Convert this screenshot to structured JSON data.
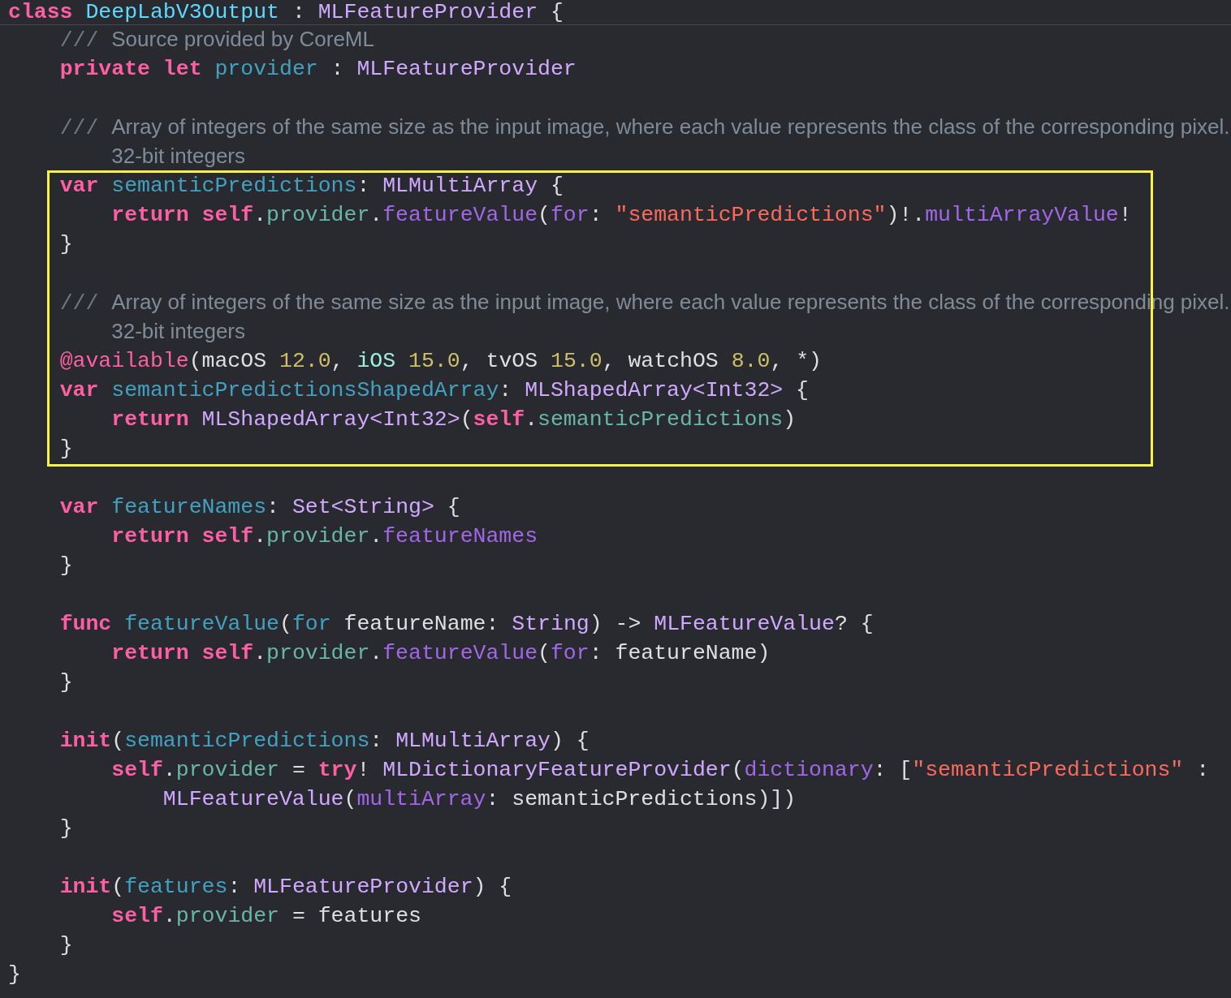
{
  "header": {
    "tokens": [
      {
        "kind": "kw",
        "text": "class "
      },
      {
        "kind": "cls",
        "text": "DeepLabV3Output"
      },
      {
        "kind": "p",
        "text": " : "
      },
      {
        "kind": "type",
        "text": "MLFeatureProvider"
      },
      {
        "kind": "p",
        "text": " {"
      }
    ]
  },
  "lines": [
    {
      "kind": "doc",
      "tokens": [
        {
          "kind": "docmark",
          "text": "    ///"
        },
        {
          "kind": "doc",
          "text": " Source provided by CoreML"
        }
      ]
    },
    {
      "kind": "code",
      "tokens": [
        {
          "kind": "kw",
          "text": "    private let "
        },
        {
          "kind": "decl",
          "text": "provider"
        },
        {
          "kind": "p",
          "text": " : "
        },
        {
          "kind": "type",
          "text": "MLFeatureProvider"
        }
      ]
    },
    {
      "kind": "blank"
    },
    {
      "kind": "doc",
      "tokens": [
        {
          "kind": "docmark",
          "text": "    ///"
        },
        {
          "kind": "doc",
          "text": " Array of integers of the same size as the input image, where each value represents the class of the corresponding pixel."
        }
      ]
    },
    {
      "kind": "doc",
      "tokens": [
        {
          "kind": "doc",
          "text": "        32-bit integers"
        }
      ]
    },
    {
      "kind": "highlight_group",
      "lines": [
        {
          "kind": "code",
          "tokens": [
            {
              "kind": "kw",
              "text": "    var "
            },
            {
              "kind": "decl",
              "text": "semanticPredictions"
            },
            {
              "kind": "p",
              "text": ": "
            },
            {
              "kind": "type",
              "text": "MLMultiArray"
            },
            {
              "kind": "p",
              "text": " {"
            }
          ]
        },
        {
          "kind": "code",
          "tokens": [
            {
              "kind": "kw",
              "text": "        return self"
            },
            {
              "kind": "p",
              "text": "."
            },
            {
              "kind": "ref",
              "text": "provider"
            },
            {
              "kind": "p",
              "text": "."
            },
            {
              "kind": "sys",
              "text": "featureValue"
            },
            {
              "kind": "p",
              "text": "("
            },
            {
              "kind": "sys",
              "text": "for"
            },
            {
              "kind": "p",
              "text": ": "
            },
            {
              "kind": "str",
              "text": "\"semanticPredictions\""
            },
            {
              "kind": "p",
              "text": ")!."
            },
            {
              "kind": "sys",
              "text": "multiArrayValue"
            },
            {
              "kind": "p",
              "text": "!"
            }
          ]
        },
        {
          "kind": "code",
          "tokens": [
            {
              "kind": "p",
              "text": "    }"
            }
          ]
        },
        {
          "kind": "blank"
        },
        {
          "kind": "doc",
          "tokens": [
            {
              "kind": "docmark",
              "text": "    ///"
            },
            {
              "kind": "doc",
              "text": " Array of integers of the same size as the input image, where each value represents the class of the corresponding pixel."
            }
          ]
        },
        {
          "kind": "doc",
          "tokens": [
            {
              "kind": "doc",
              "text": "        32-bit integers"
            }
          ]
        },
        {
          "kind": "code",
          "tokens": [
            {
              "kind": "attr",
              "text": "    @available"
            },
            {
              "kind": "p",
              "text": "(macOS "
            },
            {
              "kind": "num",
              "text": "12.0"
            },
            {
              "kind": "p",
              "text": ", "
            },
            {
              "kind": "plat",
              "text": "iOS "
            },
            {
              "kind": "num",
              "text": "15.0"
            },
            {
              "kind": "p",
              "text": ", tvOS "
            },
            {
              "kind": "num",
              "text": "15.0"
            },
            {
              "kind": "p",
              "text": ", watchOS "
            },
            {
              "kind": "num",
              "text": "8.0"
            },
            {
              "kind": "p",
              "text": ", *)"
            }
          ]
        },
        {
          "kind": "code",
          "tokens": [
            {
              "kind": "kw",
              "text": "    var "
            },
            {
              "kind": "decl",
              "text": "semanticPredictionsShapedArray"
            },
            {
              "kind": "p",
              "text": ": "
            },
            {
              "kind": "type",
              "text": "MLShapedArray<Int32>"
            },
            {
              "kind": "p",
              "text": " {"
            }
          ]
        },
        {
          "kind": "code",
          "tokens": [
            {
              "kind": "kw",
              "text": "        return "
            },
            {
              "kind": "type",
              "text": "MLShapedArray<Int32>"
            },
            {
              "kind": "p",
              "text": "("
            },
            {
              "kind": "kw",
              "text": "self"
            },
            {
              "kind": "p",
              "text": "."
            },
            {
              "kind": "ref",
              "text": "semanticPredictions"
            },
            {
              "kind": "p",
              "text": ")"
            }
          ]
        },
        {
          "kind": "code",
          "tokens": [
            {
              "kind": "p",
              "text": "    }"
            }
          ]
        }
      ]
    },
    {
      "kind": "blank"
    },
    {
      "kind": "code",
      "tokens": [
        {
          "kind": "kw",
          "text": "    var "
        },
        {
          "kind": "decl",
          "text": "featureNames"
        },
        {
          "kind": "p",
          "text": ": "
        },
        {
          "kind": "type",
          "text": "Set<String>"
        },
        {
          "kind": "p",
          "text": " {"
        }
      ]
    },
    {
      "kind": "code",
      "tokens": [
        {
          "kind": "kw",
          "text": "        return self"
        },
        {
          "kind": "p",
          "text": "."
        },
        {
          "kind": "ref",
          "text": "provider"
        },
        {
          "kind": "p",
          "text": "."
        },
        {
          "kind": "sys",
          "text": "featureNames"
        }
      ]
    },
    {
      "kind": "code",
      "tokens": [
        {
          "kind": "p",
          "text": "    }"
        }
      ]
    },
    {
      "kind": "blank"
    },
    {
      "kind": "code",
      "tokens": [
        {
          "kind": "kw",
          "text": "    func "
        },
        {
          "kind": "decl",
          "text": "featureValue"
        },
        {
          "kind": "p",
          "text": "("
        },
        {
          "kind": "decl",
          "text": "for"
        },
        {
          "kind": "p",
          "text": " featureName: "
        },
        {
          "kind": "type",
          "text": "String"
        },
        {
          "kind": "p",
          "text": ") -> "
        },
        {
          "kind": "type",
          "text": "MLFeatureValue"
        },
        {
          "kind": "p",
          "text": "? {"
        }
      ]
    },
    {
      "kind": "code",
      "tokens": [
        {
          "kind": "kw",
          "text": "        return self"
        },
        {
          "kind": "p",
          "text": "."
        },
        {
          "kind": "ref",
          "text": "provider"
        },
        {
          "kind": "p",
          "text": "."
        },
        {
          "kind": "sys",
          "text": "featureValue"
        },
        {
          "kind": "p",
          "text": "("
        },
        {
          "kind": "sys",
          "text": "for"
        },
        {
          "kind": "p",
          "text": ": featureName)"
        }
      ]
    },
    {
      "kind": "code",
      "tokens": [
        {
          "kind": "p",
          "text": "    }"
        }
      ]
    },
    {
      "kind": "blank"
    },
    {
      "kind": "code",
      "tokens": [
        {
          "kind": "kw",
          "text": "    init"
        },
        {
          "kind": "p",
          "text": "("
        },
        {
          "kind": "decl",
          "text": "semanticPredictions"
        },
        {
          "kind": "p",
          "text": ": "
        },
        {
          "kind": "type",
          "text": "MLMultiArray"
        },
        {
          "kind": "p",
          "text": ") {"
        }
      ]
    },
    {
      "kind": "code",
      "tokens": [
        {
          "kind": "kw",
          "text": "        self"
        },
        {
          "kind": "p",
          "text": "."
        },
        {
          "kind": "ref",
          "text": "provider"
        },
        {
          "kind": "p",
          "text": " = "
        },
        {
          "kind": "kw",
          "text": "try"
        },
        {
          "kind": "p",
          "text": "! "
        },
        {
          "kind": "type",
          "text": "MLDictionaryFeatureProvider"
        },
        {
          "kind": "p",
          "text": "("
        },
        {
          "kind": "sys",
          "text": "dictionary"
        },
        {
          "kind": "p",
          "text": ": ["
        },
        {
          "kind": "str",
          "text": "\"semanticPredictions\""
        },
        {
          "kind": "p",
          "text": " :"
        }
      ]
    },
    {
      "kind": "code",
      "tokens": [
        {
          "kind": "type",
          "text": "            MLFeatureValue"
        },
        {
          "kind": "p",
          "text": "("
        },
        {
          "kind": "sys",
          "text": "multiArray"
        },
        {
          "kind": "p",
          "text": ": semanticPredictions)])"
        }
      ]
    },
    {
      "kind": "code",
      "tokens": [
        {
          "kind": "p",
          "text": "    }"
        }
      ]
    },
    {
      "kind": "blank"
    },
    {
      "kind": "code",
      "tokens": [
        {
          "kind": "kw",
          "text": "    init"
        },
        {
          "kind": "p",
          "text": "("
        },
        {
          "kind": "decl",
          "text": "features"
        },
        {
          "kind": "p",
          "text": ": "
        },
        {
          "kind": "type",
          "text": "MLFeatureProvider"
        },
        {
          "kind": "p",
          "text": ") {"
        }
      ]
    },
    {
      "kind": "code",
      "tokens": [
        {
          "kind": "kw",
          "text": "        self"
        },
        {
          "kind": "p",
          "text": "."
        },
        {
          "kind": "ref",
          "text": "provider"
        },
        {
          "kind": "p",
          "text": " = features"
        }
      ]
    },
    {
      "kind": "code",
      "tokens": [
        {
          "kind": "p",
          "text": "    }"
        }
      ]
    },
    {
      "kind": "code",
      "tokens": [
        {
          "kind": "p",
          "text": "}"
        }
      ]
    }
  ]
}
